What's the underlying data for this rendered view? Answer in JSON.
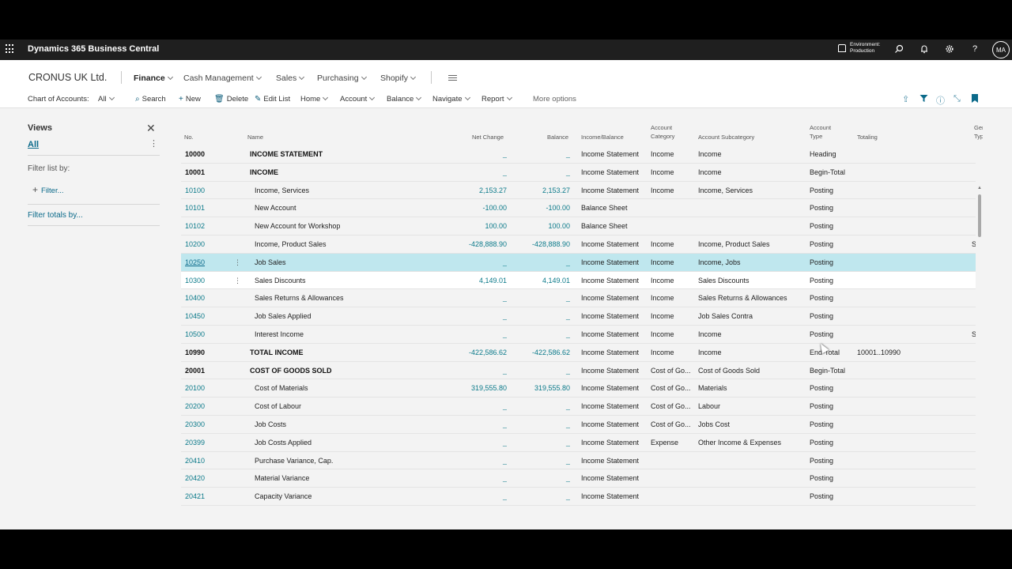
{
  "suite": {
    "app_title": "Dynamics 365 Business Central",
    "env_line1": "Environment:",
    "env_line2": "Production",
    "avatar": "MA"
  },
  "nav": {
    "company": "CRONUS UK Ltd.",
    "items": [
      "Finance",
      "Cash Management",
      "Sales",
      "Purchasing",
      "Shopify"
    ]
  },
  "actions": {
    "page_label": "Chart of Accounts:",
    "view_filter": "All",
    "search": "Search",
    "new": "New",
    "delete": "Delete",
    "edit_list": "Edit List",
    "home": "Home",
    "account": "Account",
    "balance": "Balance",
    "navigate": "Navigate",
    "report": "Report",
    "more_options": "More options"
  },
  "views": {
    "title": "Views",
    "all": "All",
    "filter_list_by": "Filter list by:",
    "add_filter": "Filter...",
    "filter_totals_by": "Filter totals by..."
  },
  "columns": {
    "no": "No.",
    "name": "Name",
    "net_change": "Net Change",
    "balance": "Balance",
    "income_balance": "Income/Balance",
    "account_category_1": "Account",
    "account_category_2": "Category",
    "account_subcategory": "Account Subcategory",
    "account_type_1": "Account",
    "account_type_2": "Type",
    "totaling": "Totaling",
    "gen_1": "Gen",
    "gen_2": "Typ"
  },
  "rows": [
    {
      "no": "10000",
      "name": "INCOME STATEMENT",
      "net": "_",
      "bal": "_",
      "ib": "Income Statement",
      "cat": "Income",
      "sub": "Income",
      "type": "Heading",
      "tot": "",
      "ext": "",
      "bold": true
    },
    {
      "no": "10001",
      "name": "INCOME",
      "net": "_",
      "bal": "_",
      "ib": "Income Statement",
      "cat": "Income",
      "sub": "Income",
      "type": "Begin-Total",
      "tot": "",
      "ext": "",
      "bold": true
    },
    {
      "no": "10100",
      "name": "Income, Services",
      "net": "2,153.27",
      "bal": "2,153.27",
      "ib": "Income Statement",
      "cat": "Income",
      "sub": "Income, Services",
      "type": "Posting",
      "tot": "",
      "ext": ""
    },
    {
      "no": "10101",
      "name": "New Account",
      "net": "-100.00",
      "bal": "-100.00",
      "ib": "Balance Sheet",
      "cat": "",
      "sub": "",
      "type": "Posting",
      "tot": "",
      "ext": ""
    },
    {
      "no": "10102",
      "name": "New Account for Workshop",
      "net": "100.00",
      "bal": "100.00",
      "ib": "Balance Sheet",
      "cat": "",
      "sub": "",
      "type": "Posting",
      "tot": "",
      "ext": ""
    },
    {
      "no": "10200",
      "name": "Income, Product Sales",
      "net": "-428,888.90",
      "bal": "-428,888.90",
      "ib": "Income Statement",
      "cat": "Income",
      "sub": "Income, Product Sales",
      "type": "Posting",
      "tot": "",
      "ext": "S"
    },
    {
      "no": "10250",
      "name": "Job Sales",
      "net": "_",
      "bal": "_",
      "ib": "Income Statement",
      "cat": "Income",
      "sub": "Income, Jobs",
      "type": "Posting",
      "tot": "",
      "ext": "",
      "selected": true
    },
    {
      "no": "10300",
      "name": "Sales Discounts",
      "net": "4,149.01",
      "bal": "4,149.01",
      "ib": "Income Statement",
      "cat": "Income",
      "sub": "Sales Discounts",
      "type": "Posting",
      "tot": "",
      "ext": "",
      "hover": true
    },
    {
      "no": "10400",
      "name": "Sales Returns & Allowances",
      "net": "_",
      "bal": "_",
      "ib": "Income Statement",
      "cat": "Income",
      "sub": "Sales Returns & Allowances",
      "type": "Posting",
      "tot": "",
      "ext": ""
    },
    {
      "no": "10450",
      "name": "Job Sales Applied",
      "net": "_",
      "bal": "_",
      "ib": "Income Statement",
      "cat": "Income",
      "sub": "Job Sales Contra",
      "type": "Posting",
      "tot": "",
      "ext": ""
    },
    {
      "no": "10500",
      "name": "Interest Income",
      "net": "_",
      "bal": "_",
      "ib": "Income Statement",
      "cat": "Income",
      "sub": "Income",
      "type": "Posting",
      "tot": "",
      "ext": "S"
    },
    {
      "no": "10990",
      "name": "TOTAL INCOME",
      "net": "-422,586.62",
      "bal": "-422,586.62",
      "ib": "Income Statement",
      "cat": "Income",
      "sub": "Income",
      "type": "End-Total",
      "tot": "10001..10990",
      "ext": "",
      "bold": true
    },
    {
      "no": "20001",
      "name": "COST OF GOODS SOLD",
      "net": "_",
      "bal": "_",
      "ib": "Income Statement",
      "cat": "Cost of Go...",
      "sub": "Cost of Goods Sold",
      "type": "Begin-Total",
      "tot": "",
      "ext": "",
      "bold": true
    },
    {
      "no": "20100",
      "name": "Cost of Materials",
      "net": "319,555.80",
      "bal": "319,555.80",
      "ib": "Income Statement",
      "cat": "Cost of Go...",
      "sub": "Materials",
      "type": "Posting",
      "tot": "",
      "ext": ""
    },
    {
      "no": "20200",
      "name": "Cost of Labour",
      "net": "_",
      "bal": "_",
      "ib": "Income Statement",
      "cat": "Cost of Go...",
      "sub": "Labour",
      "type": "Posting",
      "tot": "",
      "ext": ""
    },
    {
      "no": "20300",
      "name": "Job Costs",
      "net": "_",
      "bal": "_",
      "ib": "Income Statement",
      "cat": "Cost of Go...",
      "sub": "Jobs Cost",
      "type": "Posting",
      "tot": "",
      "ext": ""
    },
    {
      "no": "20399",
      "name": "Job Costs Applied",
      "net": "_",
      "bal": "_",
      "ib": "Income Statement",
      "cat": "Expense",
      "sub": "Other Income & Expenses",
      "type": "Posting",
      "tot": "",
      "ext": ""
    },
    {
      "no": "20410",
      "name": "Purchase Variance, Cap.",
      "net": "_",
      "bal": "_",
      "ib": "Income Statement",
      "cat": "",
      "sub": "",
      "type": "Posting",
      "tot": "",
      "ext": ""
    },
    {
      "no": "20420",
      "name": "Material Variance",
      "net": "_",
      "bal": "_",
      "ib": "Income Statement",
      "cat": "",
      "sub": "",
      "type": "Posting",
      "tot": "",
      "ext": ""
    },
    {
      "no": "20421",
      "name": "Capacity Variance",
      "net": "_",
      "bal": "_",
      "ib": "Income Statement",
      "cat": "",
      "sub": "",
      "type": "Posting",
      "tot": "",
      "ext": ""
    }
  ]
}
